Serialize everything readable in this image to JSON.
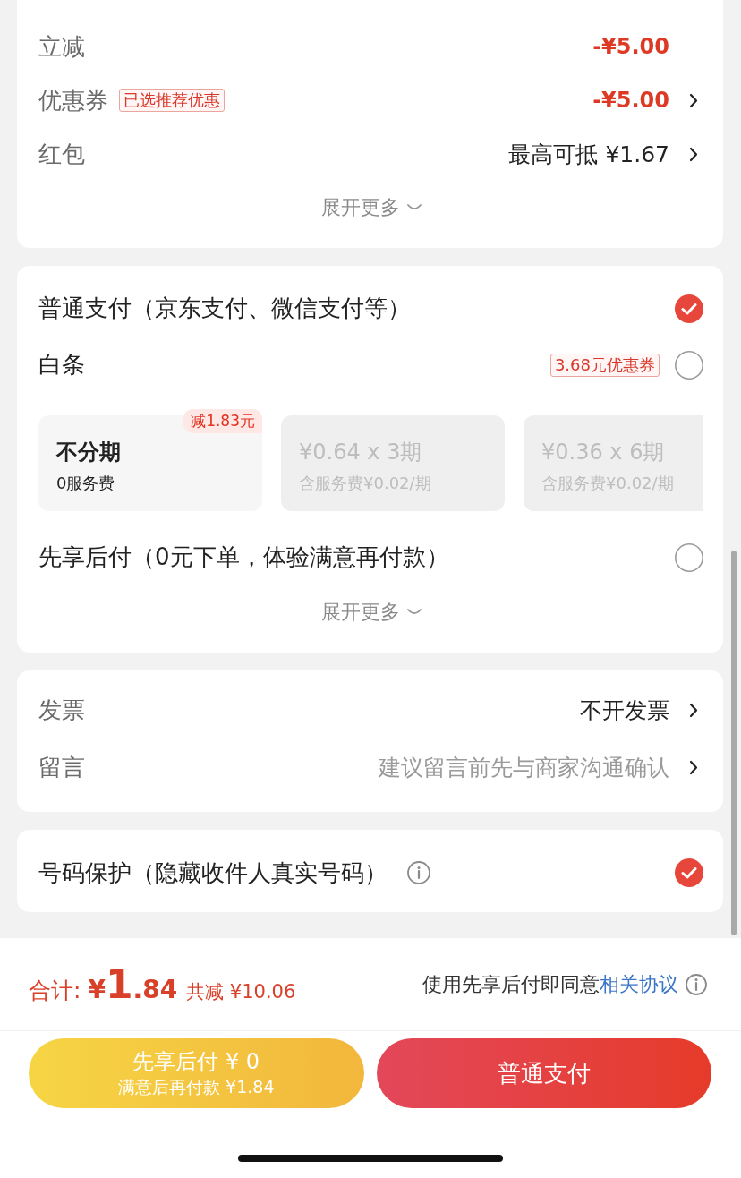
{
  "price": {
    "rows": [
      {
        "label": "立减",
        "value": "-¥5.00",
        "emphasis": true,
        "arrow": false
      },
      {
        "label": "优惠券",
        "tag": "已选推荐优惠",
        "value": "-¥5.00",
        "emphasis": true,
        "arrow": true
      },
      {
        "label": "红包",
        "value": "最高可抵 ¥1.67",
        "emphasis": false,
        "arrow": true
      }
    ],
    "expand": "展开更多"
  },
  "payment": {
    "methods": [
      {
        "label": "普通支付（京东支付、微信支付等）",
        "selected": true
      },
      {
        "label": "白条",
        "tag": "3.68元优惠券",
        "selected": false,
        "plans": [
          {
            "title": "不分期",
            "subtitle": "0服务费",
            "badge": "减1.83元",
            "disabled": false
          },
          {
            "title": "¥0.64 x 3期",
            "subtitle": "含服务费¥0.02/期",
            "disabled": true
          },
          {
            "title": "¥0.36 x 6期",
            "subtitle": "含服务费¥0.02/期",
            "disabled": true
          }
        ]
      },
      {
        "label": "先享后付（0元下单，体验满意再付款）",
        "selected": false
      }
    ],
    "expand": "展开更多"
  },
  "extras": {
    "rows": [
      {
        "label": "发票",
        "value": "不开发票"
      },
      {
        "label": "留言",
        "placeholder": "建议留言前先与商家沟通确认"
      }
    ]
  },
  "privacy": {
    "label": "号码保护（隐藏收件人真实号码）",
    "checked": true
  },
  "footer": {
    "total_label": "合计:",
    "total": "¥1.84",
    "saved": "共减 ¥10.06",
    "agreement": "使用先享后付即同意",
    "agreement_link": "相关协议",
    "buttons": [
      {
        "kind": "pay_later",
        "lines": [
          "先享后付 ¥ 0",
          "满意后再付款 ¥1.84"
        ]
      },
      {
        "kind": "pay_now",
        "lines": [
          "普通支付"
        ]
      }
    ]
  }
}
